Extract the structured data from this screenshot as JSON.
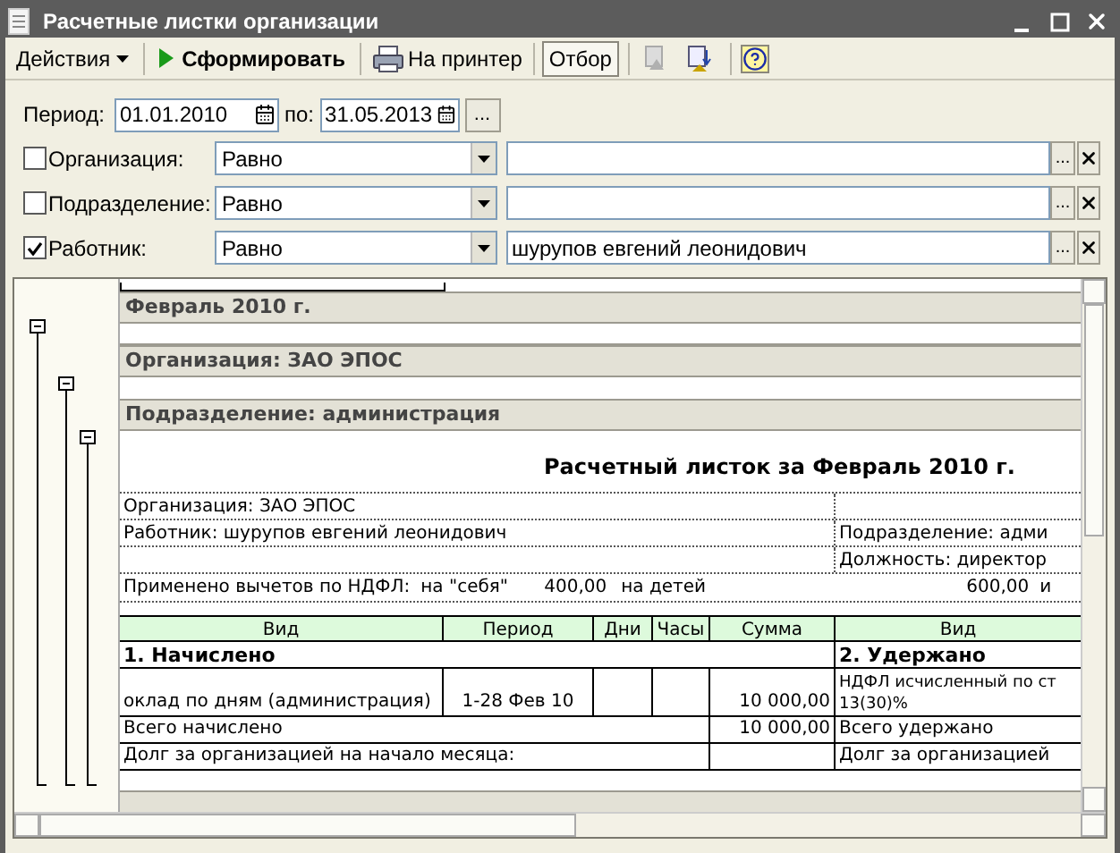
{
  "window": {
    "title": "Расчетные листки организации"
  },
  "toolbar": {
    "actions_menu": "Действия",
    "generate": "Сформировать",
    "print": "На принтер",
    "filter": {
      "label": "Отбор",
      "selected": true
    }
  },
  "period": {
    "label": "Период:",
    "from": "01.01.2010",
    "to_label": "по:",
    "to": "31.05.2013",
    "more": "..."
  },
  "filters": [
    {
      "label": "Организация:",
      "checked": false,
      "condition": "Равно",
      "select": "..."
    },
    {
      "label": "Подразделение:",
      "checked": false,
      "condition": "Равно",
      "select": "..."
    },
    {
      "label": "Работник:",
      "checked": true,
      "condition": "Равно",
      "value": "шурупов евгений леонидович",
      "select": "..."
    }
  ],
  "report": {
    "groups": [
      "Февраль 2010 г.",
      "Организация: ЗАО ЭПОС",
      "Подразделение: администрация"
    ],
    "sheet_title": "Расчетный листок за Февраль 2010 г.",
    "info_rows": [
      {
        "left": "Организация: ЗАО ЭПОС"
      },
      {
        "left": "Работник: шурупов евгений леонидович",
        "right": "Подразделение: адми"
      },
      {
        "right": "Должность: директор"
      }
    ],
    "deductions": {
      "label": "Применено вычетов по НДФЛ:",
      "self_label": "на \"себя\"",
      "self_amount": "400,00",
      "children_label": "на детей",
      "children_amount": "600,00",
      "column_7": "и"
    },
    "table": {
      "columns": [
        "Вид",
        "Период",
        "Дни",
        "Часы",
        "Сумма"
      ],
      "right_column": "Вид",
      "accrued_section": "1. Начислено",
      "withheld_section": "2. Удержано",
      "rows": [
        {
          "kind": "item",
          "name": "оклад по дням (администрация)",
          "period": "1-28 Фев 10",
          "amount": "10 000,00",
          "right_lines": [
            "НДФЛ исчисленный по ст",
            "13(30)%"
          ]
        },
        {
          "kind": "total",
          "name": "Всего начислено",
          "amount": "10 000,00",
          "right_lines": [
            "Всего удержано"
          ]
        },
        {
          "kind": "debt",
          "name": "Долг за организацией на начало месяца:",
          "right_lines": [
            "Долг за организацией"
          ]
        }
      ]
    }
  }
}
